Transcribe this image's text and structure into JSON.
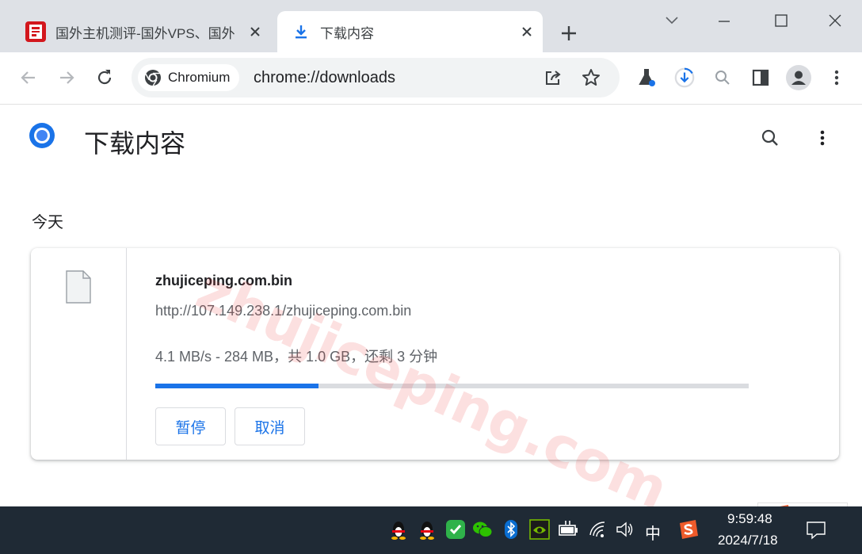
{
  "tabs": [
    {
      "title": "国外主机测评-国外VPS、国外",
      "favicon": "site-favicon"
    },
    {
      "title": "下载内容",
      "favicon": "download-icon"
    }
  ],
  "omnibox": {
    "chip_label": "Chromium",
    "url": "chrome://downloads"
  },
  "page": {
    "title": "下载内容",
    "date_header": "今天"
  },
  "download": {
    "file_name": "zhujiceping.com.bin",
    "url": "http://107.149.238.1/zhujiceping.com.bin",
    "progress_text": "4.1 MB/s - 284 MB，共 1.0 GB，还剩 3 分钟",
    "progress_percent": 27.5,
    "pause_label": "暂停",
    "cancel_label": "取消"
  },
  "watermark": "zhujiceping.com",
  "taskbar": {
    "ime_indicator": "中",
    "time": "9:59:48",
    "date": "2024/7/18"
  },
  "colors": {
    "accent": "#1a73e8",
    "tabstrip": "#dee1e6",
    "taskbar": "#1f2a35"
  }
}
